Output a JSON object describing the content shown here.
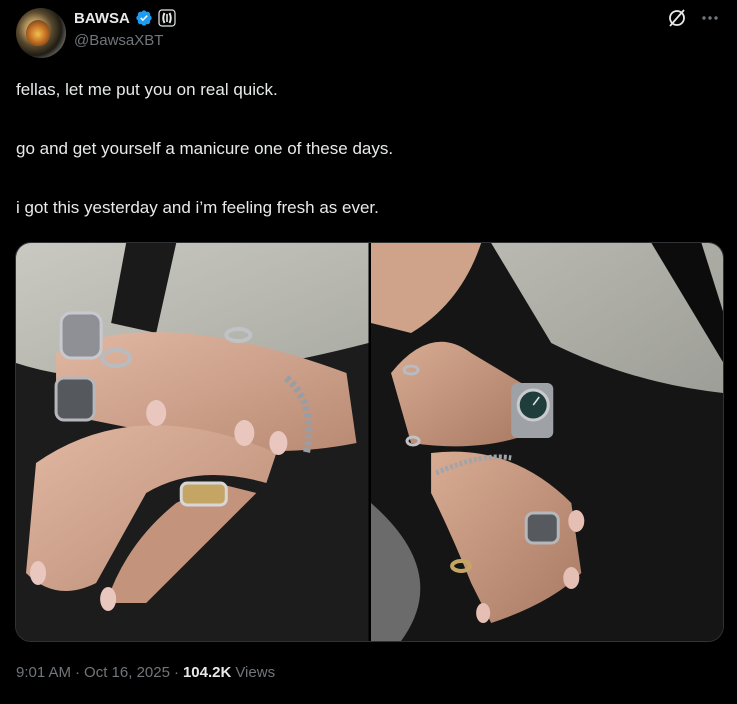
{
  "author": {
    "display_name": "BAWSA",
    "handle": "@BawsaXBT",
    "avatar_icon": "avatar-image",
    "verified_color": "#1d9bf0"
  },
  "tweet": {
    "lines": [
      "fellas, let me put you on real quick.",
      "go and get yourself a manicure one of these days.",
      "i got this yesterday and i’m feeling fresh as ever."
    ]
  },
  "media": {
    "images": [
      {
        "description_icon": "hands-with-rings-photo"
      },
      {
        "description_icon": "hands-with-watch-photo"
      }
    ]
  },
  "meta": {
    "time": "9:01 AM",
    "separator": "·",
    "date": "Oct 16, 2025",
    "views_count": "104.2K",
    "views_label": "Views"
  },
  "colors": {
    "background": "#000000",
    "text_primary": "#e7e9ea",
    "text_secondary": "#71767b",
    "border": "#2f3336"
  }
}
